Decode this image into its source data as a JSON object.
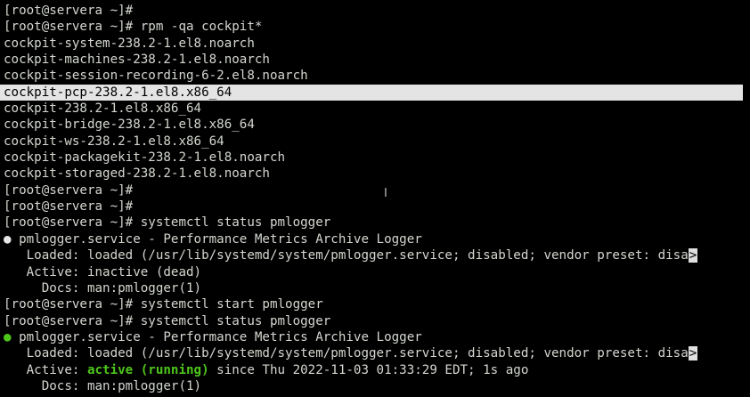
{
  "terminal": {
    "lines": [
      "[root@servera ~]#",
      "[root@servera ~]# rpm -qa cockpit*",
      "cockpit-system-238.2-1.el8.noarch",
      "cockpit-machines-238.2-1.el8.noarch",
      "cockpit-session-recording-6-2.el8.noarch",
      "cockpit-pcp-238.2-1.el8.x86_64",
      "cockpit-238.2-1.el8.x86_64",
      "cockpit-bridge-238.2-1.el8.x86_64",
      "cockpit-ws-238.2-1.el8.x86_64",
      "cockpit-packagekit-238.2-1.el8.noarch",
      "cockpit-storaged-238.2-1.el8.noarch",
      "[root@servera ~]#",
      "[root@servera ~]#",
      "[root@servera ~]# systemctl status pmlogger",
      " pmlogger.service - Performance Metrics Archive Logger",
      "   Loaded: loaded (/usr/lib/systemd/system/pmlogger.service; disabled; vendor preset: disa",
      "   Active: inactive (dead)",
      "     Docs: man:pmlogger(1)",
      "[root@servera ~]# systemctl start pmlogger",
      "[root@servera ~]# systemctl status pmlogger",
      " pmlogger.service - Performance Metrics Archive Logger",
      "   Loaded: loaded (/usr/lib/systemd/system/pmlogger.service; disabled; vendor preset: disa",
      "   Active: ",
      "active (running)",
      " since Thu 2022-11-03 01:33:29 EDT; 1s ago",
      "     Docs: man:pmlogger(1)"
    ],
    "status_dot_inactive": "●",
    "status_dot_active": "●",
    "truncation_marker": ">",
    "cursor_glyph": "I",
    "colors": {
      "background": "#000000",
      "foreground": "#d3d7cf",
      "highlight_background": "#e4e4e4",
      "active_green": "#4ec51b"
    }
  }
}
